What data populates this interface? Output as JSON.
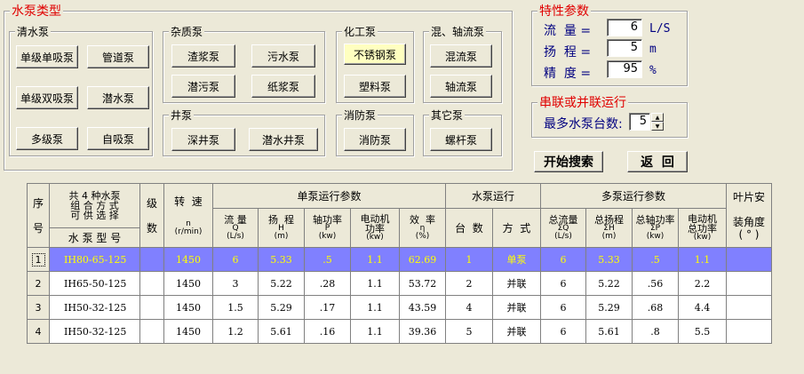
{
  "pump_types": {
    "title": "水泵类型",
    "clear_water": {
      "title": "清水泵",
      "buttons": [
        "单级单吸泵",
        "管道泵",
        "单级双吸泵",
        "潜水泵",
        "多级泵",
        "自吸泵"
      ]
    },
    "impurity": {
      "title": "杂质泵",
      "buttons": [
        "渣浆泵",
        "污水泵",
        "潜污泵",
        "纸浆泵"
      ]
    },
    "well": {
      "title": "井泵",
      "buttons": [
        "深井泵",
        "潜水井泵"
      ]
    },
    "chemical": {
      "title": "化工泵",
      "buttons": [
        "不锈钢泵",
        "塑料泵"
      ]
    },
    "fire": {
      "title": "消防泵",
      "buttons": [
        "消防泵"
      ]
    },
    "mixed": {
      "title": "混、轴流泵",
      "buttons": [
        "混流泵",
        "轴流泵"
      ]
    },
    "other": {
      "title": "其它泵",
      "buttons": [
        "螺杆泵"
      ]
    }
  },
  "params": {
    "title": "特性参数",
    "flow": {
      "label": "流  量 =",
      "value": "6",
      "unit": "L/S"
    },
    "head": {
      "label": "扬  程 =",
      "value": "5",
      "unit": "m"
    },
    "accuracy": {
      "label": "精  度 =",
      "value": "95",
      "unit": "%"
    }
  },
  "series": {
    "title": "串联或并联运行",
    "max_label": "最多水泵台数:",
    "max_value": "5"
  },
  "actions": {
    "search": "开始搜索",
    "back": "返  回"
  },
  "grid": {
    "headers": {
      "seq": [
        "序",
        "号"
      ],
      "choice": [
        "共 4 种水泵",
        "组 合 方 式",
        "可 供 选 择"
      ],
      "model": "水 泵 型 号",
      "stage": [
        "级",
        "数"
      ],
      "speed": [
        "转  速",
        "n",
        "(r/min)"
      ],
      "single": "单泵运行参数",
      "single_cols": [
        [
          "流 量",
          "Q",
          "(L/s)"
        ],
        [
          "扬  程",
          "H",
          "(m)"
        ],
        [
          "轴功率",
          "P",
          "(kw)"
        ],
        [
          "电动机",
          "功率",
          "(kw)"
        ],
        [
          "效  率",
          "η",
          "(%)"
        ]
      ],
      "run": "水泵运行",
      "run_cols": [
        "台  数",
        "方  式"
      ],
      "multi": "多泵运行参数",
      "multi_cols": [
        [
          "总流量",
          "ΣQ",
          "(L/s)"
        ],
        [
          "总扬程",
          "ΣH",
          "(m)"
        ],
        [
          "总轴功率",
          "ΣP",
          "(kw)"
        ],
        [
          "电动机",
          "总功率",
          "(kw)"
        ]
      ],
      "blade": [
        "叶片安",
        "装角度",
        "( ° )"
      ]
    },
    "rows": [
      [
        "1",
        "IH80-65-125",
        "",
        "1450",
        "6",
        "5.33",
        ".5",
        "1.1",
        "62.69",
        "1",
        "单泵",
        "6",
        "5.33",
        ".5",
        "1.1",
        ""
      ],
      [
        "2",
        "IH65-50-125",
        "",
        "1450",
        "3",
        "5.22",
        ".28",
        "1.1",
        "53.72",
        "2",
        "并联",
        "6",
        "5.22",
        ".56",
        "2.2",
        ""
      ],
      [
        "3",
        "IH50-32-125",
        "",
        "1450",
        "1.5",
        "5.29",
        ".17",
        "1.1",
        "43.59",
        "4",
        "并联",
        "6",
        "5.29",
        ".68",
        "4.4",
        ""
      ],
      [
        "4",
        "IH50-32-125",
        "",
        "1450",
        "1.2",
        "5.61",
        ".16",
        "1.1",
        "39.36",
        "5",
        "并联",
        "6",
        "5.61",
        ".8",
        "5.5",
        ""
      ]
    ],
    "selected_row": 0
  }
}
